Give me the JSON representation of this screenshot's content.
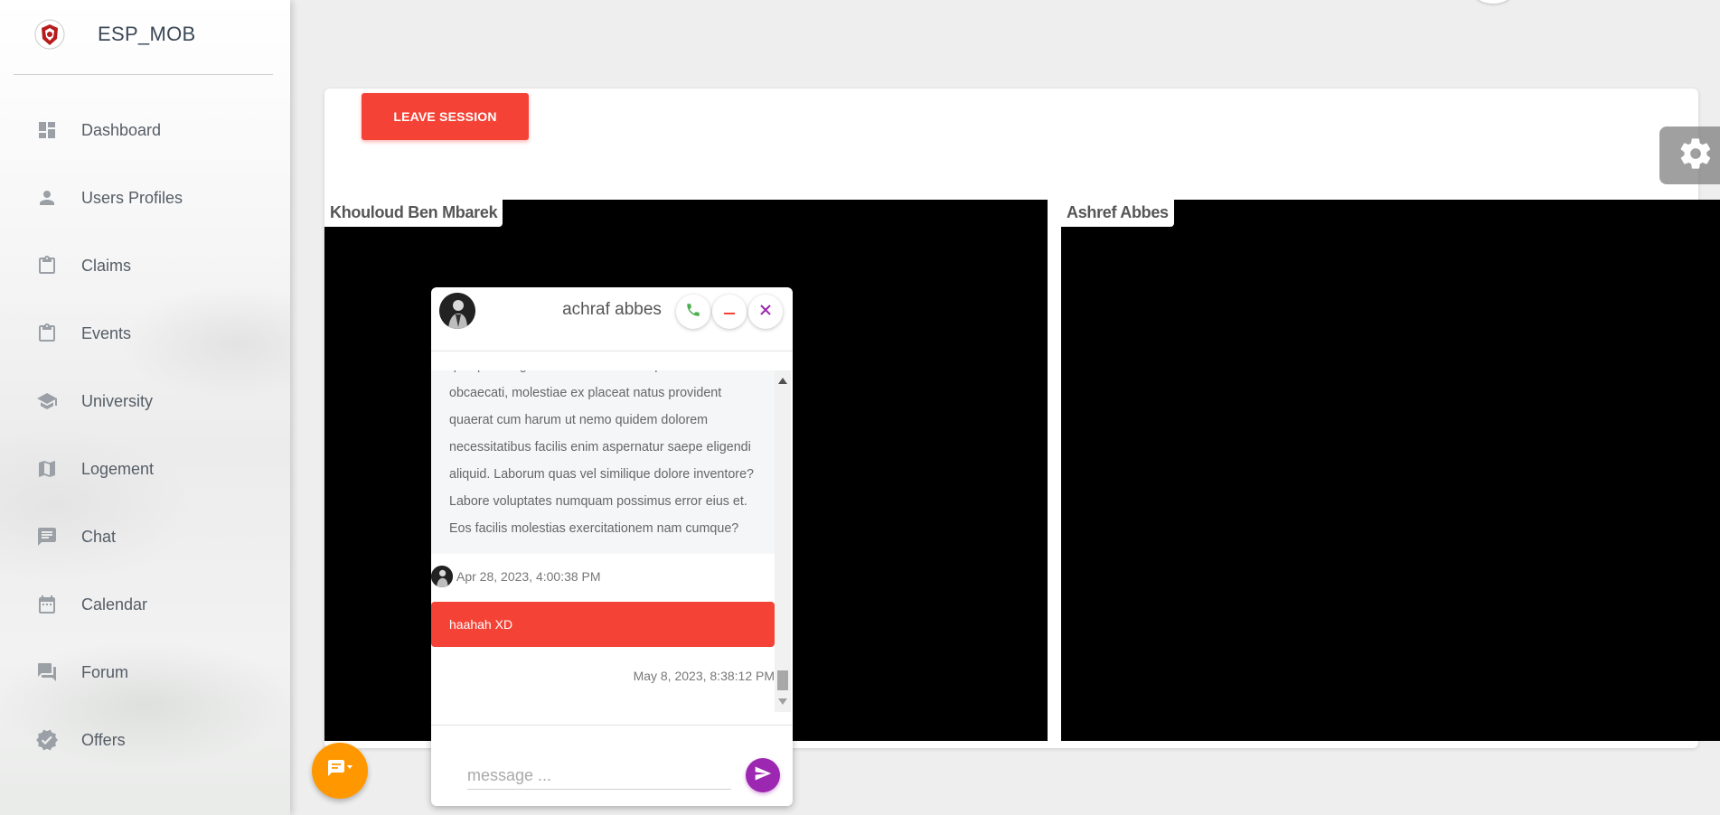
{
  "brand": {
    "name": "ESP_MOB"
  },
  "sidebar": {
    "items": [
      {
        "label": "Dashboard",
        "icon": "dashboard-icon"
      },
      {
        "label": "Users Profiles",
        "icon": "person-icon"
      },
      {
        "label": "Claims",
        "icon": "clipboard-icon"
      },
      {
        "label": "Events",
        "icon": "clipboard-icon"
      },
      {
        "label": "University",
        "icon": "school-icon"
      },
      {
        "label": "Logement",
        "icon": "map-icon"
      },
      {
        "label": "Chat",
        "icon": "chat-icon"
      },
      {
        "label": "Calendar",
        "icon": "calendar-icon"
      },
      {
        "label": "Forum",
        "icon": "forum-icon"
      },
      {
        "label": "Offers",
        "icon": "verified-icon"
      }
    ]
  },
  "session": {
    "leave_label": "LEAVE SESSION",
    "participants": [
      "Khouloud Ben Mbarek",
      "Ashref Abbes"
    ]
  },
  "chat": {
    "title": "achraf abbes",
    "received_text": "quisquam fugiat omnis eos! Soluta quo iste rem obcaecati, molestiae ex placeat natus provident quaerat cum harum ut nemo quidem dolorem necessitatibus facilis enim aspernatur saepe eligendi aliquid. Laborum quas vel similique dolore inventore? Labore voluptates numquam possimus error eius et. Eos facilis molestias exercitationem nam cumque?",
    "received_time": "Apr 28, 2023, 4:00:38 PM",
    "sent_text": "haahah XD",
    "sent_time": "May 8, 2023, 8:38:12 PM",
    "input_placeholder": "message ..."
  },
  "colors": {
    "danger": "#f44336",
    "call": "#4caf50",
    "close": "#9c27b0",
    "send": "#9c27b0",
    "fab": "#ff9800"
  }
}
